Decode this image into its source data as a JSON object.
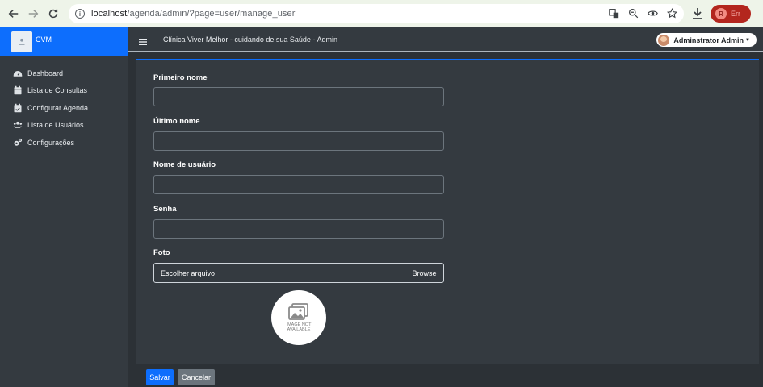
{
  "browser": {
    "url_host": "localhost",
    "url_path": "/agenda/admin/?page=user/manage_user",
    "profile_initial": "R",
    "profile_label": "Err"
  },
  "sidebar": {
    "brand": "CVM",
    "items": [
      {
        "label": "Dashboard",
        "icon": "dashboard-icon"
      },
      {
        "label": "Lista de Consultas",
        "icon": "calendar-icon"
      },
      {
        "label": "Configurar Agenda",
        "icon": "calendar-check-icon"
      },
      {
        "label": "Lista de Usuários",
        "icon": "users-icon"
      },
      {
        "label": "Configurações",
        "icon": "gears-icon"
      }
    ]
  },
  "header": {
    "title": "Clínica Viver Melhor - cuidando de sua Saúde - Admin",
    "user_name": "Adminstrator Admin"
  },
  "form": {
    "first_name": {
      "label": "Primeiro nome",
      "value": ""
    },
    "last_name": {
      "label": "Último nome",
      "value": ""
    },
    "username": {
      "label": "Nome de usuário",
      "value": ""
    },
    "password": {
      "label": "Senha",
      "value": ""
    },
    "photo": {
      "label": "Foto",
      "placeholder": "Escolher arquivo",
      "browse": "Browse"
    },
    "preview_text": "IMAGE NOT AVAILABLE"
  },
  "actions": {
    "save": "Salvar",
    "cancel": "Cancelar"
  },
  "colors": {
    "accent": "#0d6efd",
    "sidebar_bg": "#343a40",
    "cancel": "#6c757d"
  }
}
